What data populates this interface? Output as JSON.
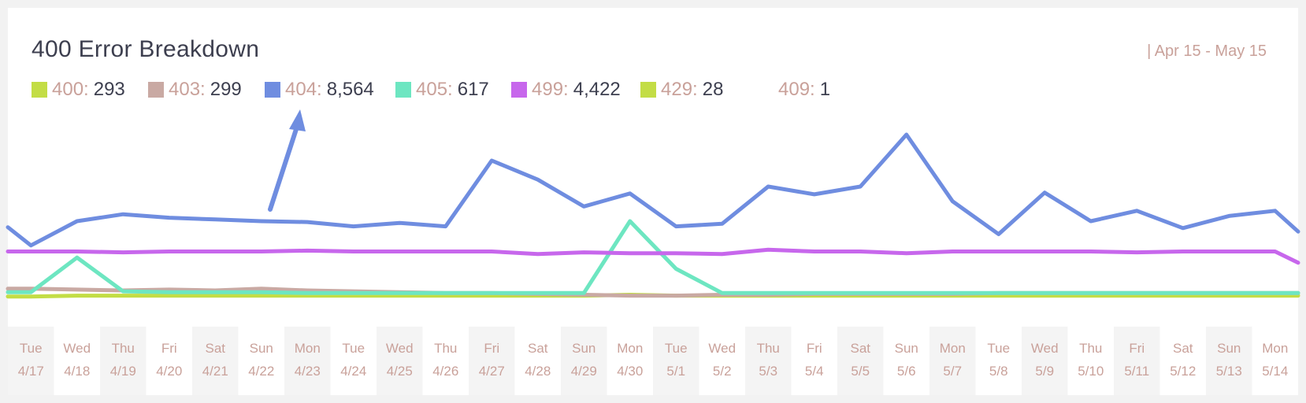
{
  "header": {
    "title": "400 Error Breakdown",
    "date_range": "| Apr 15 - May 15"
  },
  "legend": [
    {
      "code": "400:",
      "count": "293",
      "color": "#c3dd45"
    },
    {
      "code": "403:",
      "count": "299",
      "color": "#c9a9a3"
    },
    {
      "code": "404:",
      "count": "8,564",
      "color": "#6f8de0"
    },
    {
      "code": "405:",
      "count": "617",
      "color": "#6de6c1"
    },
    {
      "code": "499:",
      "count": "4,422",
      "color": "#c767ec"
    },
    {
      "code": "429:",
      "count": "28",
      "color": "#c3dd45"
    },
    {
      "code": "409:",
      "count": "1",
      "color": ""
    }
  ],
  "chart_data": {
    "type": "line",
    "categories": [
      {
        "day": "Tue",
        "date": "4/17"
      },
      {
        "day": "Wed",
        "date": "4/18"
      },
      {
        "day": "Thu",
        "date": "4/19"
      },
      {
        "day": "Fri",
        "date": "4/20"
      },
      {
        "day": "Sat",
        "date": "4/21"
      },
      {
        "day": "Sun",
        "date": "4/22"
      },
      {
        "day": "Mon",
        "date": "4/23"
      },
      {
        "day": "Tue",
        "date": "4/24"
      },
      {
        "day": "Wed",
        "date": "4/25"
      },
      {
        "day": "Thu",
        "date": "4/26"
      },
      {
        "day": "Fri",
        "date": "4/27"
      },
      {
        "day": "Sat",
        "date": "4/28"
      },
      {
        "day": "Sun",
        "date": "4/29"
      },
      {
        "day": "Mon",
        "date": "4/30"
      },
      {
        "day": "Tue",
        "date": "5/1"
      },
      {
        "day": "Wed",
        "date": "5/2"
      },
      {
        "day": "Thu",
        "date": "5/3"
      },
      {
        "day": "Fri",
        "date": "5/4"
      },
      {
        "day": "Sat",
        "date": "5/5"
      },
      {
        "day": "Sun",
        "date": "5/6"
      },
      {
        "day": "Mon",
        "date": "5/7"
      },
      {
        "day": "Tue",
        "date": "5/8"
      },
      {
        "day": "Wed",
        "date": "5/9"
      },
      {
        "day": "Thu",
        "date": "5/10"
      },
      {
        "day": "Fri",
        "date": "5/11"
      },
      {
        "day": "Sat",
        "date": "5/12"
      },
      {
        "day": "Sun",
        "date": "5/13"
      },
      {
        "day": "Mon",
        "date": "5/14"
      }
    ],
    "series": [
      {
        "name": "400",
        "color": "#c3dd45",
        "values": [
          3,
          4,
          4,
          4,
          4,
          4,
          4,
          4,
          4,
          4,
          4,
          4,
          4,
          5,
          4,
          4,
          4,
          4,
          4,
          4,
          4,
          4,
          4,
          4,
          4,
          4,
          4,
          4
        ]
      },
      {
        "name": "403",
        "color": "#c9a9a3",
        "values": [
          12,
          11,
          10,
          11,
          10,
          12,
          10,
          9,
          8,
          7,
          7,
          6,
          5,
          4,
          4,
          5,
          5,
          6,
          6,
          6,
          6,
          7,
          7,
          7,
          7,
          7,
          7,
          7
        ]
      },
      {
        "name": "405",
        "color": "#6de6c1",
        "values": [
          8,
          48,
          9,
          8,
          8,
          8,
          7,
          7,
          7,
          7,
          7,
          7,
          7,
          90,
          35,
          7,
          7,
          7,
          7,
          7,
          7,
          7,
          7,
          7,
          7,
          7,
          7,
          7
        ]
      },
      {
        "name": "499",
        "color": "#c767ec",
        "values": [
          55,
          55,
          54,
          55,
          55,
          55,
          56,
          55,
          55,
          55,
          55,
          52,
          54,
          53,
          53,
          52,
          57,
          55,
          55,
          53,
          55,
          55,
          55,
          55,
          54,
          55,
          55,
          55
        ]
      },
      {
        "name": "404",
        "color": "#6f8de0",
        "values": [
          62,
          90,
          98,
          94,
          92,
          90,
          89,
          84,
          88,
          84,
          160,
          138,
          107,
          122,
          84,
          87,
          130,
          121,
          130,
          190,
          113,
          75,
          123,
          90,
          102,
          82,
          96,
          102
        ]
      }
    ],
    "first_visible_values": {
      "404": 83,
      "405": 8,
      "499": 55,
      "403": 12,
      "400": 3
    },
    "last_visible_values": {
      "404": 78,
      "499": 42
    }
  }
}
